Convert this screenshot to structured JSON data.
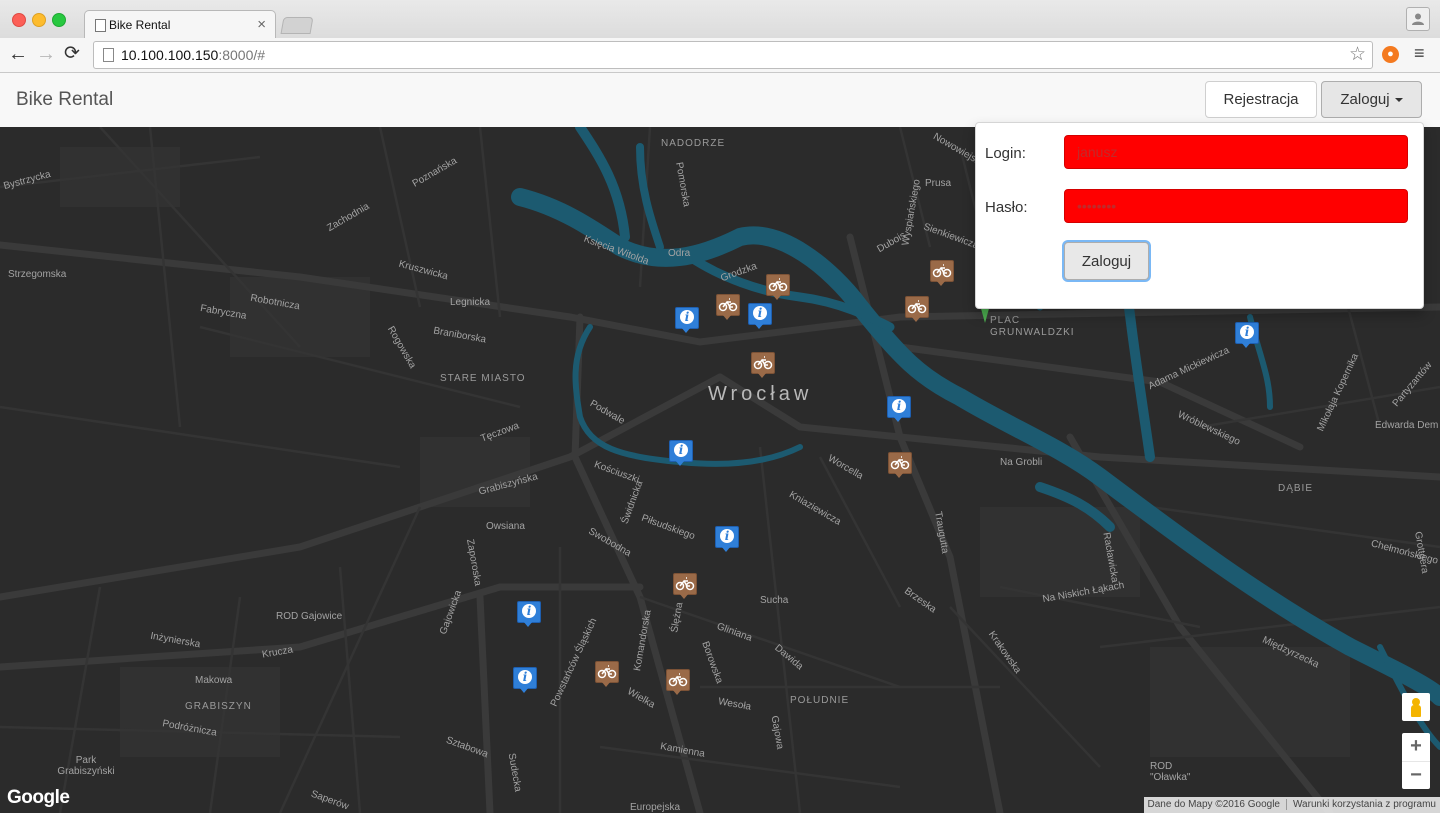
{
  "browser": {
    "tab_title": "Bike Rental",
    "tab_close": "×",
    "url_host": "10.100.100.150",
    "url_rest": ":8000/#",
    "back_icon": "←",
    "forward_icon": "→",
    "reload_icon": "⟳",
    "bookmark_icon": "☆",
    "menu_icon": "≡",
    "profile_icon": "person-icon"
  },
  "navbar": {
    "brand": "Bike Rental",
    "register_label": "Rejestracja",
    "login_label": "Zaloguj"
  },
  "login_form": {
    "login_label": "Login:",
    "login_placeholder": "janusz",
    "password_label": "Hasło:",
    "password_placeholder": "••••••••",
    "submit_label": "Zaloguj",
    "field_color": "#ff0000"
  },
  "map": {
    "city_label": "Wrocław",
    "districts": [
      "NADODRZE",
      "STARE MIASTO",
      "PLAC GRUNWALDZKI",
      "DĄBIE",
      "POŁUDNIE",
      "GRABISZYN",
      "ROD Gajowice",
      "ROD \"Oławka\""
    ],
    "streets": [
      "Bystrzycka",
      "Strzegomska",
      "Legnicka",
      "Zachodnia",
      "Poznańska",
      "Kruszwicka",
      "Fabryczna",
      "Robotnicza",
      "Braniborska",
      "Rogowska",
      "Podwale",
      "Odra",
      "Księcia Witolda",
      "Grodzka",
      "Nowowiejska",
      "Prusa",
      "Sienkiewicza",
      "Wyspiańskiego",
      "Pomorska",
      "Dubois",
      "Tęczowa",
      "Grabiszyńska",
      "Owsiana",
      "Świdnicka",
      "Piłsudskiego",
      "Kościuszki",
      "Swobodna",
      "Ślężna",
      "Komandorska",
      "Powstańców Śląskich",
      "Zaporoska",
      "Gajowicka",
      "Krucza",
      "Inżynierska",
      "Makowa",
      "Podróżnicza",
      "Sztabowa",
      "Kamienna",
      "Borowska",
      "Gliniana",
      "Wielka",
      "Wesoła",
      "Gajowa",
      "Dawida",
      "Sucha",
      "Krakowska",
      "Na Niskich Łąkach",
      "Międzyrzecka",
      "Adama Mickiewicza",
      "Wróblewskiego",
      "Edwarda Dem",
      "Grottgera",
      "Chełmońskiego",
      "Na Grobli",
      "Traugutta",
      "Brzeska",
      "Worcella",
      "Kniaziewicza",
      "Racławicka",
      "Mikołaja Kopernika",
      "Partyzantów",
      "Sudecka",
      "Europejska",
      "Saperów",
      "Park Grabiszyński"
    ],
    "google_logo": "Google",
    "attribution": "Dane do Mapy ©2016 Google",
    "terms": "Warunki korzystania z programu",
    "zoom_in": "+",
    "zoom_out": "−",
    "info_marker_icon": "info-icon",
    "bike_marker_icon": "bicycle-icon",
    "info_marker_color": "#2f7fd8",
    "bike_marker_color": "#9a6a48",
    "river_color": "#1c5a70",
    "info_marker_count": 9,
    "bike_marker_count": 10
  }
}
